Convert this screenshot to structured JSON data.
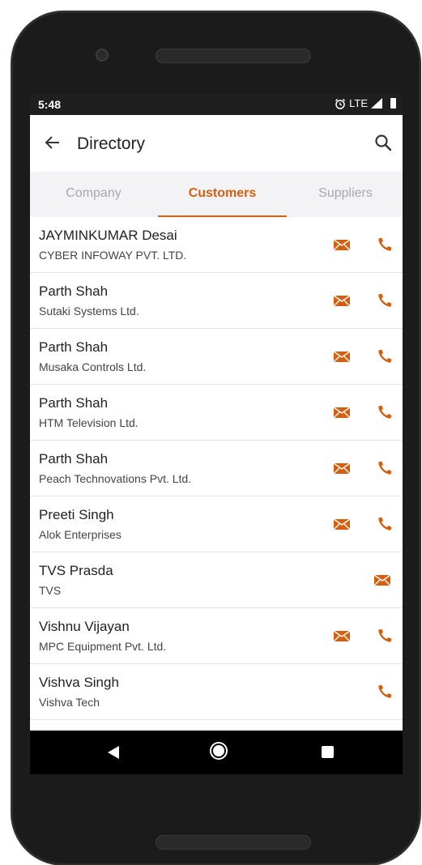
{
  "status_bar": {
    "time": "5:48",
    "network": "LTE"
  },
  "app_bar": {
    "title": "Directory"
  },
  "tabs": [
    {
      "label": "Company"
    },
    {
      "label": "Customers"
    },
    {
      "label": "Suppliers"
    }
  ],
  "active_tab": "Customers",
  "accent_color": "#d35f0f",
  "contacts": [
    {
      "name": "JAYMINKUMAR Desai",
      "company": "CYBER INFOWAY PVT. LTD.",
      "email": true,
      "phone": true
    },
    {
      "name": "Parth Shah",
      "company": "Sutaki Systems Ltd.",
      "email": true,
      "phone": true
    },
    {
      "name": "Parth Shah",
      "company": "Musaka Controls Ltd.",
      "email": true,
      "phone": true
    },
    {
      "name": "Parth Shah",
      "company": "HTM Television Ltd.",
      "email": true,
      "phone": true
    },
    {
      "name": "Parth Shah",
      "company": "Peach Technovations Pvt. Ltd.",
      "email": true,
      "phone": true
    },
    {
      "name": "Preeti Singh",
      "company": "Alok Enterprises",
      "email": true,
      "phone": true
    },
    {
      "name": "TVS Prasda",
      "company": "TVS",
      "email": true,
      "phone": false
    },
    {
      "name": "Vishnu Vijayan",
      "company": "MPC Equipment Pvt. Ltd.",
      "email": true,
      "phone": true
    },
    {
      "name": "Vishva Singh",
      "company": "Vishva Tech",
      "email": false,
      "phone": true
    }
  ]
}
